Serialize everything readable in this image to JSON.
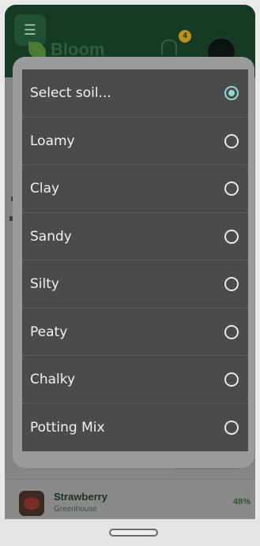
{
  "app": {
    "brand": "Bloom",
    "notification_count": "4"
  },
  "soil_dialog": {
    "options": [
      {
        "label": "Select soil...",
        "selected": true
      },
      {
        "label": "Loamy",
        "selected": false
      },
      {
        "label": "Clay",
        "selected": false
      },
      {
        "label": "Sandy",
        "selected": false
      },
      {
        "label": "Silty",
        "selected": false
      },
      {
        "label": "Peaty",
        "selected": false
      },
      {
        "label": "Chalky",
        "selected": false
      },
      {
        "label": "Potting Mix",
        "selected": false
      }
    ]
  },
  "plant_card": {
    "name": "Strawberry",
    "location": "Greenhouse",
    "progress": "48%"
  },
  "colors": {
    "radio_selected": "#8fd9d2",
    "header_bg": "#163a24",
    "dialog_bg": "#4b4b4b"
  },
  "icons": [
    "menu-icon",
    "leaf-logo-icon",
    "bell-icon",
    "avatar",
    "radio-icon"
  ]
}
